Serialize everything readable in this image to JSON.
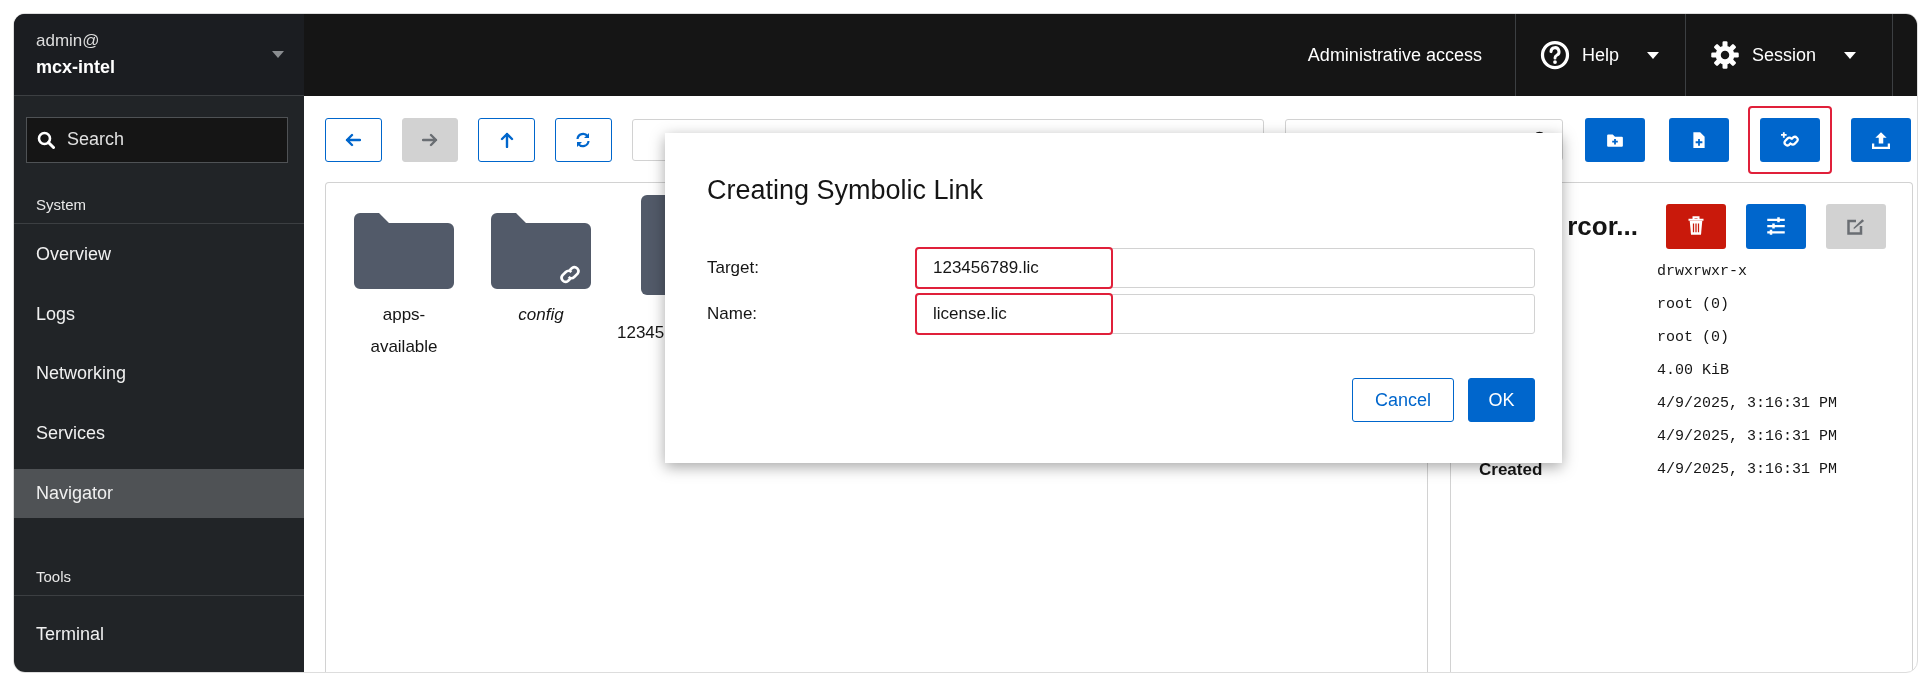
{
  "host": {
    "user": "admin@",
    "name": "mcx-intel"
  },
  "sidebar": {
    "search": {
      "placeholder": "Search"
    },
    "sections": [
      {
        "heading": "System",
        "items": [
          {
            "label": "Overview",
            "selected": false
          },
          {
            "label": "Logs",
            "selected": false
          },
          {
            "label": "Networking",
            "selected": false
          },
          {
            "label": "Services",
            "selected": false
          },
          {
            "label": "Navigator",
            "selected": true
          }
        ]
      },
      {
        "heading": "Tools",
        "items": [
          {
            "label": "Terminal",
            "selected": false
          }
        ]
      }
    ]
  },
  "topbar": {
    "access": "Administrative access",
    "menus": [
      {
        "kind": "help",
        "label": "Help"
      },
      {
        "kind": "session",
        "label": "Session"
      }
    ]
  },
  "toolbar": {
    "nav": [
      {
        "kind": "back",
        "disabled": false
      },
      {
        "kind": "forward",
        "disabled": true
      },
      {
        "kind": "up",
        "disabled": false
      },
      {
        "kind": "refresh",
        "disabled": false
      }
    ],
    "actions": [
      {
        "kind": "new-folder",
        "highlighted": false
      },
      {
        "kind": "new-file",
        "highlighted": false
      },
      {
        "kind": "symlink",
        "highlighted": true
      },
      {
        "kind": "upload",
        "highlighted": false
      }
    ]
  },
  "files": [
    {
      "name": "apps-available",
      "kind": "folder",
      "symlink": false
    },
    {
      "name": "config",
      "kind": "folder",
      "symlink": true
    },
    {
      "name": "12345",
      "kind": "file",
      "symlink": false
    }
  ],
  "details": {
    "title": "rcor...",
    "actions": [
      {
        "kind": "delete",
        "disabled": false
      },
      {
        "kind": "properties",
        "disabled": false
      },
      {
        "kind": "edit",
        "disabled": true
      }
    ],
    "rows": [
      {
        "value": "drwxrwxr-x"
      },
      {
        "value": "root (0)"
      },
      {
        "value": "root (0)"
      },
      {
        "value": "4.00 KiB"
      },
      {
        "value": "4/9/2025, 3:16:31 PM"
      },
      {
        "value": "4/9/2025, 3:16:31 PM"
      },
      {
        "label": "Created",
        "value": "4/9/2025, 3:16:31 PM"
      }
    ]
  },
  "dialog": {
    "title": "Creating Symbolic Link",
    "fields": [
      {
        "label": "Target:",
        "value": "123456789.lic",
        "highlighted": true
      },
      {
        "label": "Name:",
        "value": "license.lic",
        "highlighted": true
      }
    ],
    "buttons": [
      {
        "kind": "secondary",
        "label": "Cancel"
      },
      {
        "kind": "primary",
        "label": "OK"
      }
    ]
  }
}
